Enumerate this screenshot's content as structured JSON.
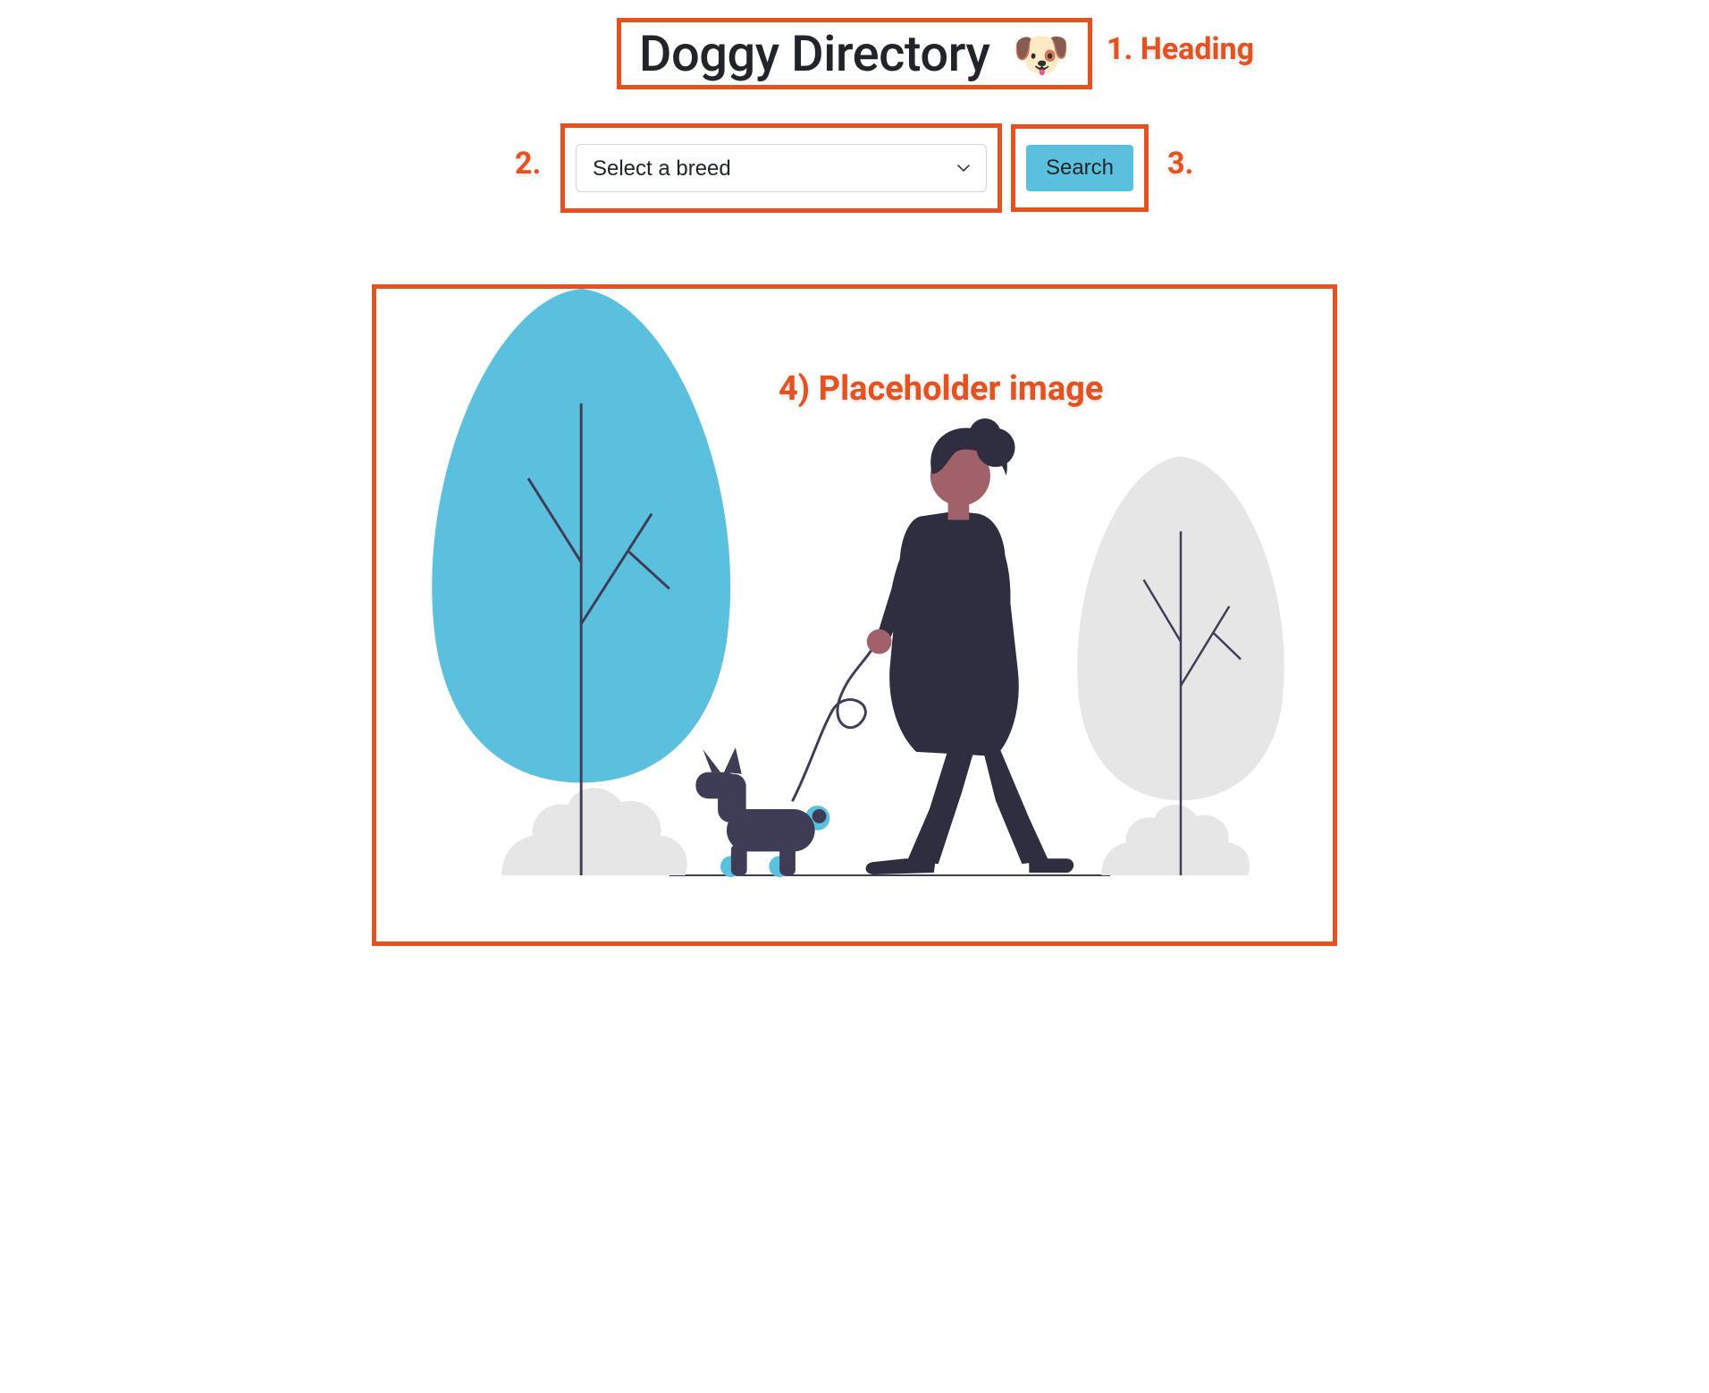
{
  "heading": {
    "title": "Doggy Directory",
    "emoji": "🐶"
  },
  "search": {
    "select_placeholder": "Select a breed",
    "button_label": "Search"
  },
  "annotations": {
    "a1": "1. Heading",
    "a2": "2.",
    "a3": "3.",
    "a4": "4) Placeholder image"
  },
  "colors": {
    "accent_orange": "#e5521f",
    "button_blue": "#5bc0de",
    "tree_blue": "#5bc0de",
    "tree_grey": "#e6e6e6",
    "person_dark": "#2f2e41",
    "person_skin": "#a0616a",
    "bush_grey": "#e6e6e6"
  }
}
